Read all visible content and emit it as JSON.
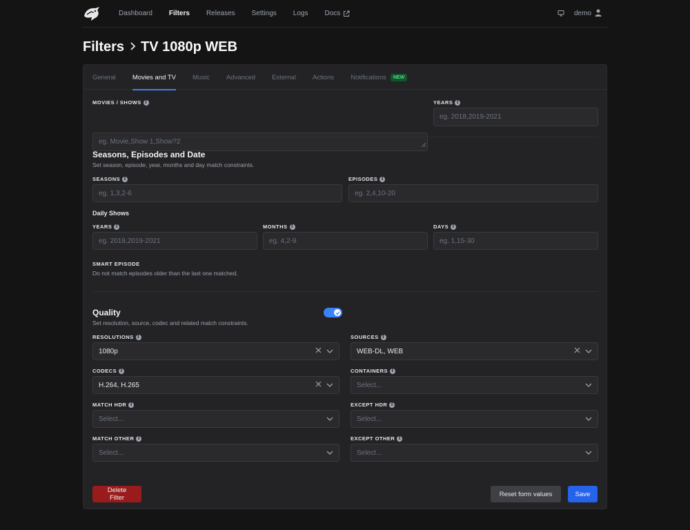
{
  "nav": {
    "links": [
      {
        "label": "Dashboard"
      },
      {
        "label": "Filters"
      },
      {
        "label": "Releases"
      },
      {
        "label": "Settings"
      },
      {
        "label": "Logs"
      },
      {
        "label": "Docs"
      }
    ],
    "active": "Filters",
    "username": "demo"
  },
  "breadcrumb": {
    "root": "Filters",
    "current": "TV 1080p WEB"
  },
  "tabs": [
    {
      "label": "General"
    },
    {
      "label": "Movies and TV"
    },
    {
      "label": "Music"
    },
    {
      "label": "Advanced"
    },
    {
      "label": "External"
    },
    {
      "label": "Actions"
    },
    {
      "label": "Notifications"
    }
  ],
  "active_tab": "Movies and TV",
  "notifications_badge": "NEW",
  "movies_shows": {
    "label": "MOVIES / SHOWS",
    "placeholder": "eg. Movie,Show 1,Show?2"
  },
  "years_top": {
    "label": "YEARS",
    "placeholder": "eg. 2018,2019-2021"
  },
  "seasons_section": {
    "title": "Seasons, Episodes and Date",
    "subtitle": "Set season, episode, year, months and day match constraints.",
    "seasons": {
      "label": "SEASONS",
      "placeholder": "eg. 1,3,2-6"
    },
    "episodes": {
      "label": "EPISODES",
      "placeholder": "eg. 2,4,10-20"
    },
    "daily_heading": "Daily Shows",
    "years": {
      "label": "YEARS",
      "placeholder": "eg. 2018,2019-2021"
    },
    "months": {
      "label": "MONTHS",
      "placeholder": "eg. 4,2-9"
    },
    "days": {
      "label": "DAYS",
      "placeholder": "eg. 1,15-30"
    },
    "smart_episode": {
      "label": "SMART EPISODE",
      "description": "Do not match episodes older than the last one matched.",
      "enabled": true
    }
  },
  "quality_section": {
    "title": "Quality",
    "subtitle": "Set resolution, source, codec and related match constraints.",
    "resolutions": {
      "label": "RESOLUTIONS",
      "value": "1080p"
    },
    "sources": {
      "label": "SOURCES",
      "value": "WEB-DL, WEB"
    },
    "codecs": {
      "label": "CODECS",
      "value": "H.264, H.265"
    },
    "containers": {
      "label": "CONTAINERS",
      "placeholder": "Select..."
    },
    "match_hdr": {
      "label": "MATCH HDR",
      "placeholder": "Select..."
    },
    "except_hdr": {
      "label": "EXCEPT HDR",
      "placeholder": "Select..."
    },
    "match_other": {
      "label": "MATCH OTHER",
      "placeholder": "Select..."
    },
    "except_other": {
      "label": "EXCEPT OTHER",
      "placeholder": "Select..."
    }
  },
  "actions": {
    "delete": "Delete Filter",
    "reset": "Reset form values",
    "save": "Save"
  },
  "colors": {
    "accent": "#3b82f6",
    "danger": "#991b1b",
    "badge": "#4ade80"
  }
}
